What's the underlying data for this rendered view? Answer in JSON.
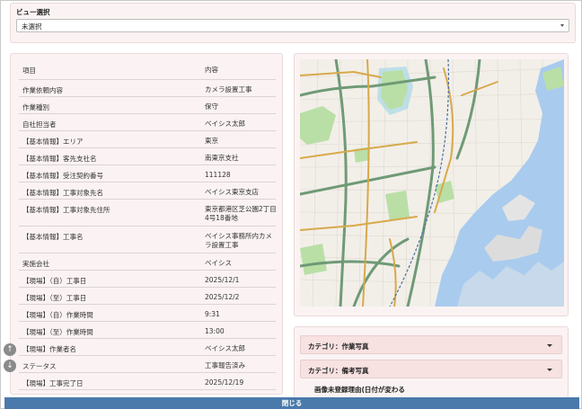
{
  "view": {
    "title": "ビュー選択",
    "selected": "未選択"
  },
  "table": {
    "headers": {
      "key": "項目",
      "value": "内容"
    },
    "rows": [
      {
        "key": "作業依頼内容",
        "value": "カメラ設置工事"
      },
      {
        "key": "作業種別",
        "value": "保守"
      },
      {
        "key": "自社担当者",
        "value": "ベイシス太郎"
      },
      {
        "key": "【基本情報】エリア",
        "value": "東京"
      },
      {
        "key": "【基本情報】客先支社名",
        "value": "南東京支社"
      },
      {
        "key": "【基本情報】受注契約番号",
        "value": "111128"
      },
      {
        "key": "【基本情報】工事対象先名",
        "value": "ベイシス東京支店"
      },
      {
        "key": "【基本情報】工事対象先住所",
        "value": "東京都港区芝公園2丁目4号18番地"
      },
      {
        "key": "【基本情報】工事名",
        "value": "ベイシス事務所内カメラ設置工事"
      },
      {
        "key": "実施会社",
        "value": "ベイシス"
      },
      {
        "key": "【現場】（自）工事日",
        "value": "2025/12/1"
      },
      {
        "key": "【現場】（至）工事日",
        "value": "2025/12/2"
      },
      {
        "key": "【現場】（自）作業時間",
        "value": "9:31"
      },
      {
        "key": "【現場】（至）作業時間",
        "value": "13:00"
      },
      {
        "key": "【現場】作業者名",
        "value": "ベイシス太郎"
      },
      {
        "key": "ステータス",
        "value": "工事報告済み"
      },
      {
        "key": "【現場】工事完了日",
        "value": "2025/12/19"
      }
    ]
  },
  "categories": [
    {
      "label": "カテゴリ：作業写真"
    },
    {
      "label": "カテゴリ：備考写真"
    }
  ],
  "category_note": "画像未登録理由(日付が変わる",
  "close_label": "閉じる",
  "icons": {
    "scroll_up": "arrow-up-icon",
    "scroll_down": "arrow-down-icon"
  },
  "colors": {
    "panel_bg": "#fbf3f3",
    "category_bg": "#f7e1e1",
    "close_bar": "#4a7aab",
    "map_water": "#a9cbee",
    "map_park": "#b9dfa6",
    "map_road_major": "#6f9a76",
    "map_road_arterial": "#d8a94a"
  }
}
